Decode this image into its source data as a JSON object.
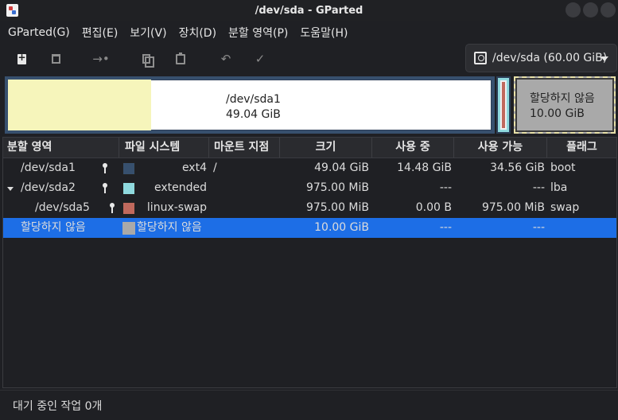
{
  "window": {
    "title": "/dev/sda - GParted"
  },
  "menu": [
    "GParted(G)",
    "편집(E)",
    "보기(V)",
    "장치(D)",
    "분할 영역(P)",
    "도움말(H)"
  ],
  "toolbar": {
    "icons": [
      "new-partition-icon",
      "delete-icon",
      "resize-move-icon",
      "copy-icon",
      "paste-icon",
      "undo-icon",
      "apply-icon"
    ]
  },
  "device": {
    "label": "/dev/sda (60.00 GiB)"
  },
  "visual": {
    "sda1": {
      "name": "/dev/sda1",
      "size": "49.04 GiB"
    },
    "unallocated": {
      "name": "할당하지 않음",
      "size": "10.00 GiB"
    }
  },
  "table": {
    "headers": [
      "분할 영역",
      "파일 시스템",
      "마운트 지점",
      "크기",
      "사용 중",
      "사용 가능",
      "플래그"
    ],
    "rows": [
      {
        "partition": "/dev/sda1",
        "fs": "ext4",
        "mount": "/",
        "size": "49.04 GiB",
        "used": "14.48 GiB",
        "free": "34.56 GiB",
        "flags": "boot",
        "color": "#37506e"
      },
      {
        "partition": "/dev/sda2",
        "fs": "extended",
        "mount": "",
        "size": "975.00 MiB",
        "used": "---",
        "free": "---",
        "flags": "lba",
        "color": "#8fd9de"
      },
      {
        "partition": "/dev/sda5",
        "fs": "linux-swap",
        "mount": "",
        "size": "975.00 MiB",
        "used": "0.00 B",
        "free": "975.00 MiB",
        "flags": "swap",
        "color": "#c0695d"
      },
      {
        "partition": "할당하지 않음",
        "fs": "할당하지 않음",
        "mount": "",
        "size": "10.00 GiB",
        "used": "---",
        "free": "---",
        "flags": "",
        "color": "#a9a9a9"
      }
    ]
  },
  "status": {
    "text": "대기 중인 작업 0개"
  }
}
